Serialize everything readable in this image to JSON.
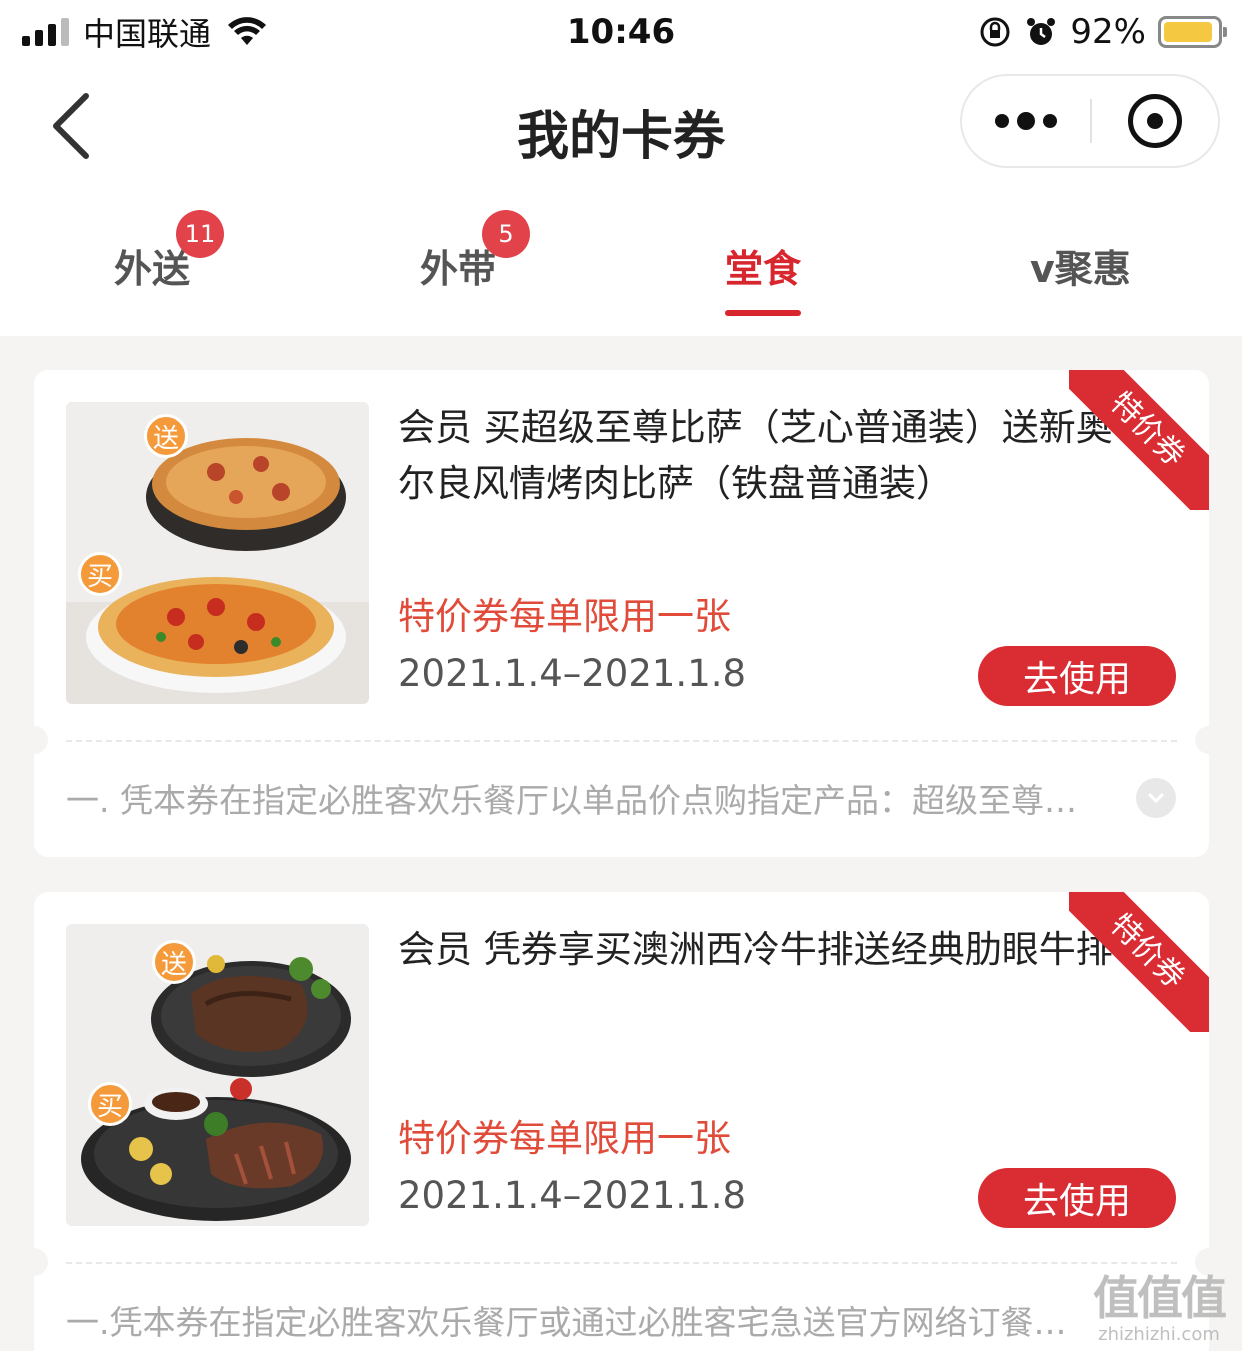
{
  "status_bar": {
    "carrier": "中国联通",
    "time": "10:46",
    "battery_percent": "92%",
    "battery_level": 0.92,
    "battery_color": "#f5c842"
  },
  "nav": {
    "title": "我的卡券",
    "back_icon": "chevron-left-icon",
    "more_icon": "more-dots-icon",
    "close_icon": "target-circle-icon"
  },
  "tabs": [
    {
      "label": "外送",
      "badge": "11",
      "active": false
    },
    {
      "label": "外带",
      "badge": "5",
      "active": false
    },
    {
      "label": "堂食",
      "badge": "",
      "active": true
    },
    {
      "label": "v聚惠",
      "badge": "",
      "active": false
    }
  ],
  "colors": {
    "accent": "#d92c33",
    "limit_text": "#e04b3a",
    "badge_bg": "#e2424a",
    "tag_orange": "#f59a3a",
    "page_bg": "#f5f4f2"
  },
  "coupons": [
    {
      "title": "会员 买超级至尊比萨（芝心普通装）送新奥尔良风情烤肉比萨（铁盘普通装）",
      "ribbon": "特价券",
      "limit": "特价券每单限用一张",
      "dates": "2021.1.4–2021.1.8",
      "use_label": "去使用",
      "tag_gift": "送",
      "tag_buy": "买",
      "description": "一. 凭本券在指定必胜客欢乐餐厅以单品价点购指定产品：超级至尊比萨"
    },
    {
      "title": "会员 凭券享买澳洲西冷牛排送经典肋眼牛排",
      "ribbon": "特价券",
      "limit": "特价券每单限用一张",
      "dates": "2021.1.4–2021.1.8",
      "use_label": "去使用",
      "tag_gift": "送",
      "tag_buy": "买",
      "description": "一.凭本券在指定必胜客欢乐餐厅或通过必胜客宅急送官方网络订餐平台"
    }
  ],
  "watermark": {
    "logo": "值值值",
    "url": "zhizhizhi.com"
  }
}
